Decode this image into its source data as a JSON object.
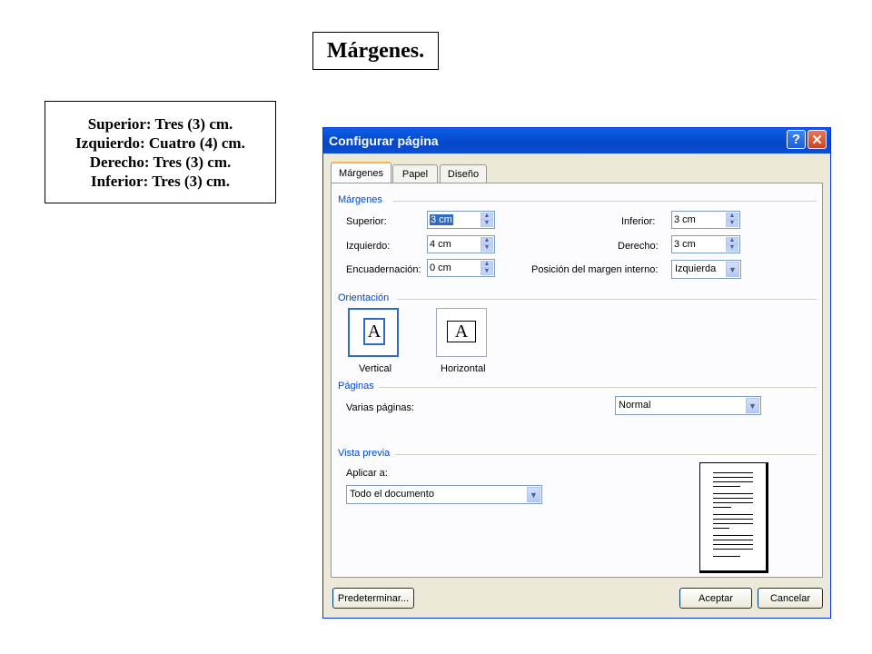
{
  "slide": {
    "title": "Márgenes.",
    "notes": [
      "Superior: Tres (3) cm.",
      "Izquierdo: Cuatro (4) cm.",
      "Derecho: Tres (3) cm.",
      "Inferior: Tres (3) cm."
    ]
  },
  "dialog": {
    "title": "Configurar página",
    "help_glyph": "?",
    "close_glyph": "✕",
    "tabs": [
      "Márgenes",
      "Papel",
      "Diseño"
    ],
    "margins": {
      "group_label": "Márgenes",
      "superior_label": "Superior:",
      "superior_value": "3 cm",
      "izquierdo_label": "Izquierdo:",
      "izquierdo_value": "4 cm",
      "encuadernacion_label": "Encuadernación:",
      "encuadernacion_value": "0 cm",
      "inferior_label": "Inferior:",
      "inferior_value": "3 cm",
      "derecho_label": "Derecho:",
      "derecho_value": "3 cm",
      "posicion_label": "Posición del margen interno:",
      "posicion_value": "Izquierda"
    },
    "orientation": {
      "group_label": "Orientación",
      "icon_letter": "A",
      "vertical_label": "Vertical",
      "horizontal_label": "Horizontal",
      "selected": "Vertical"
    },
    "pages": {
      "group_label": "Páginas",
      "multiple_label": "Varias páginas:",
      "multiple_value": "Normal"
    },
    "preview": {
      "group_label": "Vista previa",
      "apply_label": "Aplicar a:",
      "apply_value": "Todo el documento"
    },
    "buttons": {
      "default": "Predeterminar...",
      "ok": "Aceptar",
      "cancel": "Cancelar"
    }
  }
}
